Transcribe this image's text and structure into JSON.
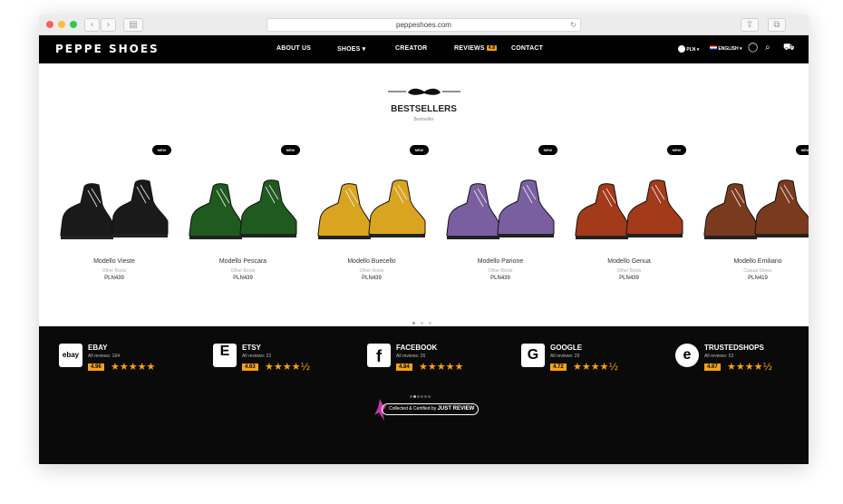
{
  "browser": {
    "url": "peppeshoes.com"
  },
  "site": {
    "logo": "PEPPE SHOES",
    "menu": [
      {
        "label": "ABOUT US"
      },
      {
        "label": "SHOES ▾"
      },
      {
        "label": "CREATOR"
      },
      {
        "label": "REVIEWS"
      },
      {
        "label": "CONTACT"
      }
    ],
    "reviews_badge": "4.8",
    "currency": "PLN",
    "language": "ENGLISH",
    "icons": [
      "currency-icon",
      "flag-icon",
      "account-icon",
      "search-icon",
      "cart-icon"
    ]
  },
  "bestsellers": {
    "title": "BESTSELLERS",
    "subtitle": "Bestseller",
    "new_label": "NEW",
    "products": [
      {
        "name": "Modello Vieste",
        "category": "Other Boots",
        "price": "PLN439",
        "color": "#1a1a1a"
      },
      {
        "name": "Modello Pescara",
        "category": "Other Boots",
        "price": "PLN439",
        "color": "#1f5a1f"
      },
      {
        "name": "Modello Buecello",
        "category": "Other Boots",
        "price": "PLN439",
        "color": "#d9a420"
      },
      {
        "name": "Modello Parione",
        "category": "Other Boots",
        "price": "PLN439",
        "color": "#7a5fa0"
      },
      {
        "name": "Modello Genua",
        "category": "Other Boots",
        "price": "PLN439",
        "color": "#a33a1a"
      },
      {
        "name": "Modello Emiliano",
        "category": "Casual Shoes",
        "price": "PLN419",
        "color": "#7a3a1e"
      }
    ]
  },
  "reviews": {
    "platforms": [
      {
        "name": "EBAY",
        "count": "All reviews: 164",
        "score": "4.96",
        "stars": "★★★★★",
        "icon": "ebay"
      },
      {
        "name": "ETSY",
        "count": "All reviews: 22",
        "score": "4.63",
        "stars": "★★★★½",
        "icon": "E"
      },
      {
        "name": "FACEBOOK",
        "count": "All reviews: 26",
        "score": "4.84",
        "stars": "★★★★★",
        "icon": "f"
      },
      {
        "name": "GOOGLE",
        "count": "All reviews: 29",
        "score": "4.72",
        "stars": "★★★★½",
        "icon": "G"
      },
      {
        "name": "TRUSTEDSHOPS",
        "count": "All reviews: 53",
        "score": "4.67",
        "stars": "★★★★½",
        "icon": "e"
      }
    ],
    "certified_text": "Collected & Certified by",
    "certified_brand": "JUST REVIEW"
  },
  "colors": {
    "accent": "#f6a21b",
    "nav_bg": "#000000",
    "reviews_bg": "#0a0a0a"
  }
}
